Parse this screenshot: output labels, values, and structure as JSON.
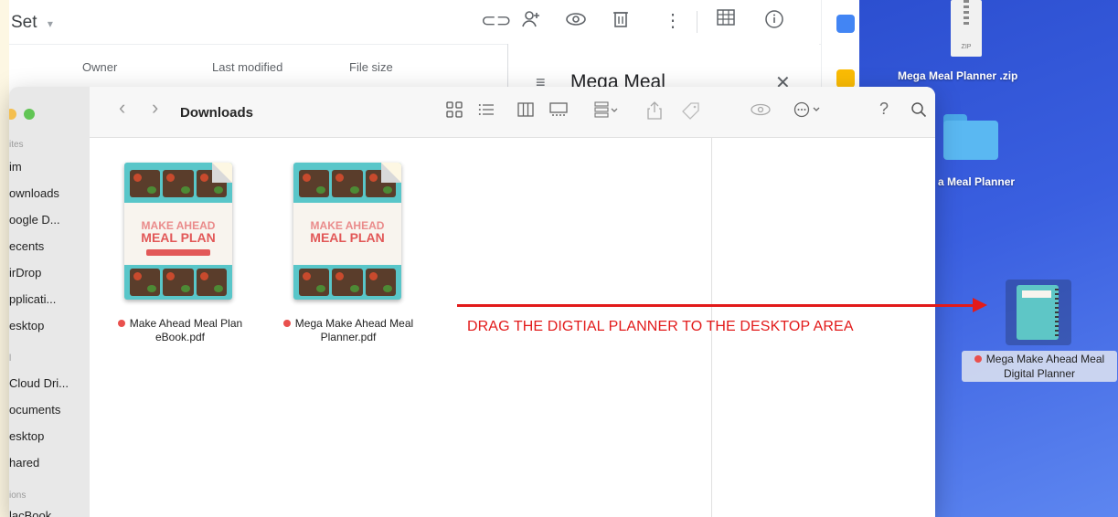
{
  "background_window": {
    "title": "Set",
    "title_caret": "▾",
    "columns": {
      "owner": "Owner",
      "last_modified": "Last modified",
      "file_size": "File size"
    },
    "details_panel": {
      "title": "Mega Meal",
      "menu_icon": "≡",
      "close_icon": "✕"
    }
  },
  "finder": {
    "toolbar": {
      "back": "‹",
      "forward": "›",
      "title": "Downloads",
      "help": "?"
    },
    "sidebar": {
      "section_favorites": "ites",
      "favorites": [
        "im",
        "ownloads",
        "oogle D...",
        "ecents",
        "irDrop",
        "pplicati...",
        "esktop"
      ],
      "section_icloud": "l",
      "icloud": [
        "Cloud Dri...",
        "ocuments",
        "esktop",
        "hared"
      ],
      "section_locations": "ions",
      "locations": [
        "lacBook"
      ]
    },
    "files": [
      {
        "label_line1": "Make Ahead Meal Plan",
        "label_line2": "eBook.pdf",
        "cover_top": "MAKE AHEAD",
        "cover_bottom": "MEAL PLAN",
        "tag_color": "#e9504d"
      },
      {
        "label_line1": "Mega Make Ahead Meal",
        "label_line2": "Planner.pdf",
        "cover_top": "MAKE AHEAD",
        "cover_bottom": "MEAL PLAN",
        "tag_color": "#e9504d"
      }
    ]
  },
  "desktop": {
    "items": [
      {
        "label": "Mega Meal Planner .zip"
      },
      {
        "label": "a Meal Planner"
      },
      {
        "label_line1": "Mega Make Ahead Meal",
        "label_line2": "Digital Planner"
      }
    ],
    "zip_badge": "ZIP"
  },
  "annotation": {
    "text": "DRAG THE DIGTIAL PLANNER TO THE  DESKTOP AREA",
    "color": "#e21a1a"
  }
}
